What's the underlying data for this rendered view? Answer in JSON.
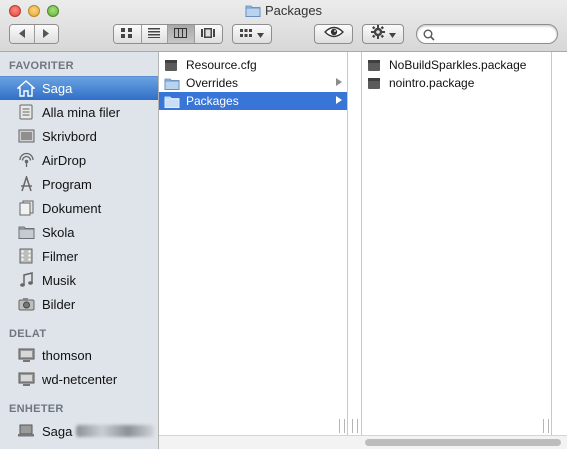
{
  "window": {
    "title": "Packages"
  },
  "toolbar": {
    "back_icon": "back-arrow-icon",
    "forward_icon": "forward-arrow-icon",
    "view_modes": [
      "icon-view",
      "list-view",
      "column-view",
      "cover-flow-view"
    ],
    "active_view": "column-view",
    "arrange_icon": "arrange-grid-icon",
    "quicklook_icon": "eye-icon",
    "action_icon": "gear-icon",
    "search": {
      "value": "",
      "placeholder": ""
    }
  },
  "sidebar": {
    "sections": {
      "favorites": "FAVORITER",
      "shared": "DELAT",
      "devices": "ENHETER"
    },
    "favorites": [
      {
        "label": "Saga",
        "icon": "home-icon",
        "selected": true
      },
      {
        "label": "Alla mina filer",
        "icon": "all-files-icon"
      },
      {
        "label": "Skrivbord",
        "icon": "desktop-icon"
      },
      {
        "label": "AirDrop",
        "icon": "airdrop-icon"
      },
      {
        "label": "Program",
        "icon": "applications-icon"
      },
      {
        "label": "Dokument",
        "icon": "documents-icon"
      },
      {
        "label": "Skola",
        "icon": "folder-icon"
      },
      {
        "label": "Filmer",
        "icon": "movies-icon"
      },
      {
        "label": "Musik",
        "icon": "music-icon"
      },
      {
        "label": "Bilder",
        "icon": "camera-icon"
      }
    ],
    "shared": [
      {
        "label": "thomson",
        "icon": "computer-icon"
      },
      {
        "label": "wd-netcenter",
        "icon": "computer-icon"
      }
    ],
    "devices": [
      {
        "label": "Saga",
        "icon": "laptop-icon"
      }
    ]
  },
  "columns": {
    "first": [
      {
        "label": "Resource.cfg",
        "icon": "file-icon",
        "has_children": false
      },
      {
        "label": "Overrides",
        "icon": "folder-icon",
        "has_children": true
      },
      {
        "label": "Packages",
        "icon": "folder-icon",
        "has_children": true,
        "selected": true
      }
    ],
    "second": [
      {
        "label": "NoBuildSparkles.package",
        "icon": "package-icon"
      },
      {
        "label": "nointro.package",
        "icon": "package-icon"
      }
    ]
  },
  "colors": {
    "selection_blue": "#3875d7",
    "sidebar_bg": "#dee4ea",
    "sidebar_selected": "#2f6fc7"
  }
}
